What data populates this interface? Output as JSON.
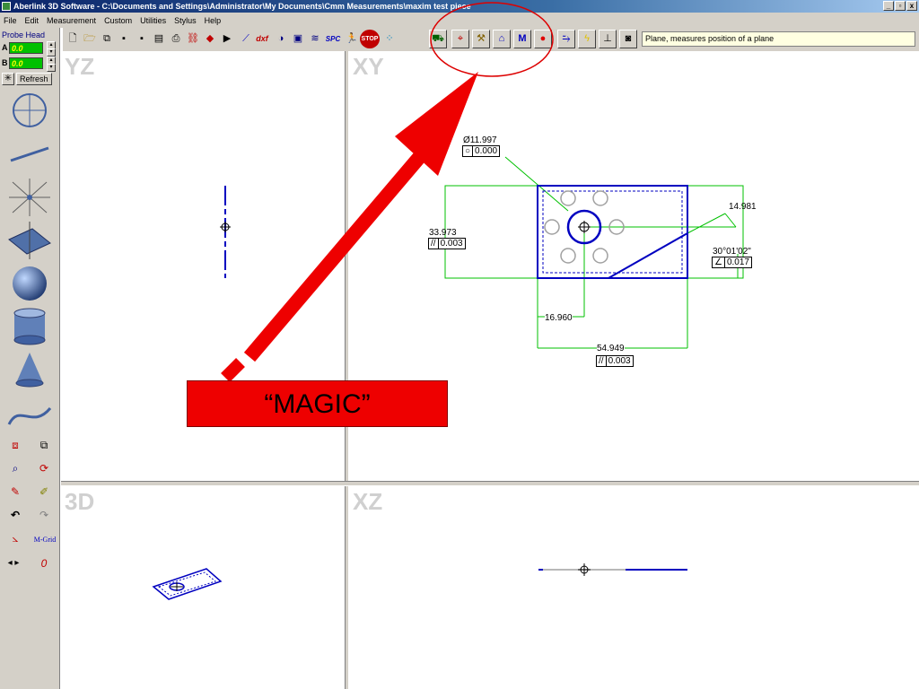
{
  "window": {
    "title": "Aberlink 3D Software - C:\\Documents and Settings\\Administrator\\My Documents\\Cmm Measurements\\maxim test piece",
    "buttons": {
      "minimize": "_",
      "maximize": "▫",
      "close": "x"
    }
  },
  "menu": [
    "File",
    "Edit",
    "Measurement",
    "Custom",
    "Utilities",
    "Stylus",
    "Help"
  ],
  "toolbar": {
    "status_text": "Plane, measures position of a plane",
    "dxf_label": "dxf",
    "spc_label": "SPC",
    "stop_label": "STOP",
    "m_label": "M"
  },
  "probe_head": {
    "label": "Probe Head",
    "a_label": "A",
    "a_value": "0.0",
    "b_label": "B",
    "b_value": "0.0",
    "refresh_label": "Refresh"
  },
  "left_tools": {
    "mgrid_label": "M-Grid",
    "zero_label": "0"
  },
  "viewports": {
    "yz": "YZ",
    "xy": "XY",
    "three_d": "3D",
    "xz": "XZ"
  },
  "annotation": {
    "magic_label": "“MAGIC”"
  },
  "dimensions": {
    "diameter": "Ø11.997",
    "circularity_symbol": "○",
    "circularity": "0.000",
    "height_dim": "33.973",
    "parallel_symbol": "//",
    "height_parallel": "0.003",
    "right_dim": "14.981",
    "angle": "30°01'02\"",
    "angle_symbol": "∠",
    "angle_tol": "0.017",
    "bottom_small": "16.960",
    "bottom_width": "54.949",
    "bottom_parallel": "0.003"
  },
  "colors": {
    "outline_blue": "#0000c0",
    "dim_green": "#00c000",
    "arrow_red": "#ee0000",
    "title_blue": "#0a246a"
  }
}
